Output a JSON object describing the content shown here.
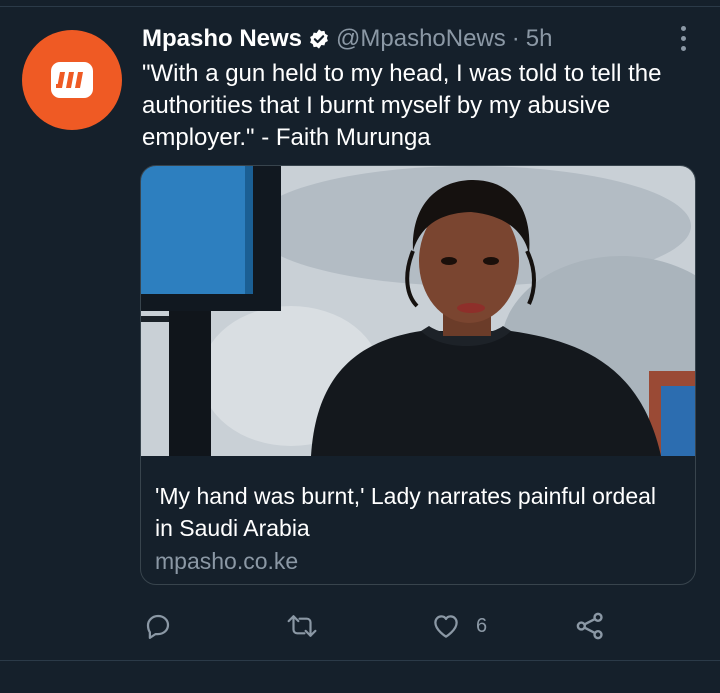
{
  "tweet": {
    "display_name": "Mpasho News",
    "handle": "@MpashoNews",
    "separator": "·",
    "time": "5h",
    "text": "\"With a gun held to my head, I was told to tell the authorities that I burnt myself by my abusive employer.\" -  Faith Murunga",
    "avatar_icon": "mpasho-logo-icon",
    "avatar_color": "#ef5a24",
    "verified_icon": "verified-badge-icon"
  },
  "card": {
    "title": "'My hand was burnt,' Lady narrates painful ordeal in Saudi Arabia",
    "domain": "mpasho.co.ke"
  },
  "actions": {
    "reply_icon": "reply-icon",
    "retweet_icon": "retweet-icon",
    "like_icon": "heart-icon",
    "like_count": "6",
    "share_icon": "share-icon"
  },
  "colors": {
    "background": "#15202b",
    "secondary_text": "#8b98a5",
    "border": "#38444d"
  }
}
